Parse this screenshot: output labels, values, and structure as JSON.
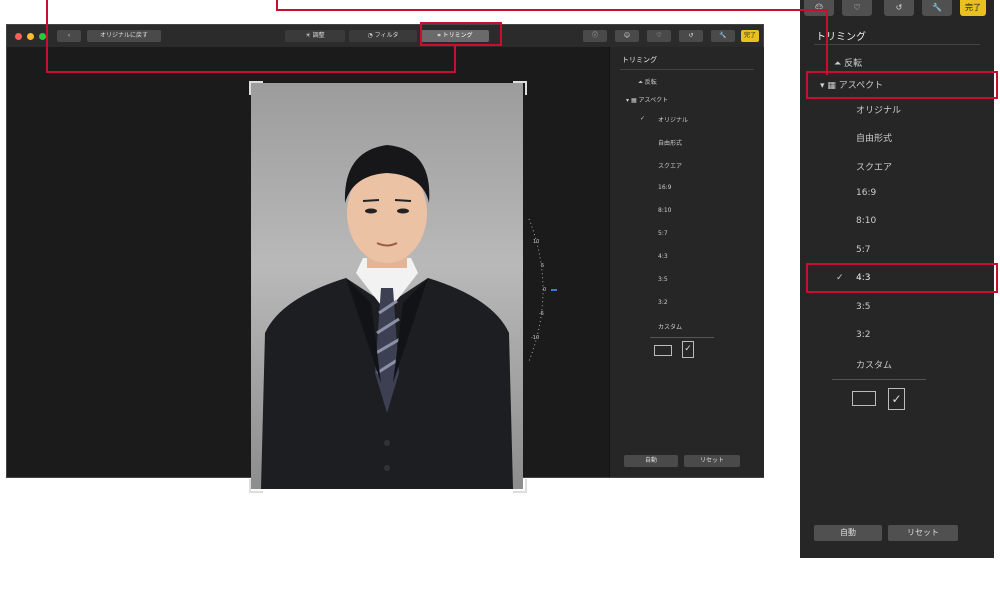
{
  "window": {
    "revert_label": "オリジナルに戻す",
    "tabs": [
      {
        "label": "調整"
      },
      {
        "label": "フィルタ"
      },
      {
        "label": "トリミング"
      }
    ],
    "done_label": "完了"
  },
  "sidebar": {
    "title": "トリミング",
    "flip_label": "反転",
    "aspect_label": "アスペクト",
    "aspect_items": [
      "オリジナル",
      "自由形式",
      "スクエア",
      "16:9",
      "8:10",
      "5:7",
      "4:3",
      "3:5",
      "3:2",
      "カスタム"
    ],
    "selected_item_main": "オリジナル",
    "auto_label": "自動",
    "reset_label": "リセット"
  },
  "rotation_dial": {
    "ticks": [
      "10",
      "5",
      "0",
      "-5",
      "-10"
    ]
  },
  "zoom_panel": {
    "title": "トリミング",
    "flip_label": "反転",
    "aspect_label": "アスペクト",
    "aspect_items": [
      "オリジナル",
      "自由形式",
      "スクエア",
      "16:9",
      "8:10",
      "5:7",
      "4:3",
      "3:5",
      "3:2",
      "カスタム"
    ],
    "selected_item": "4:3",
    "done_label": "完了",
    "auto_label": "自動",
    "reset_label": "リセット"
  },
  "colors": {
    "highlight": "#c8102e",
    "done_yellow": "#e8c020",
    "panel_bg": "#262626"
  }
}
